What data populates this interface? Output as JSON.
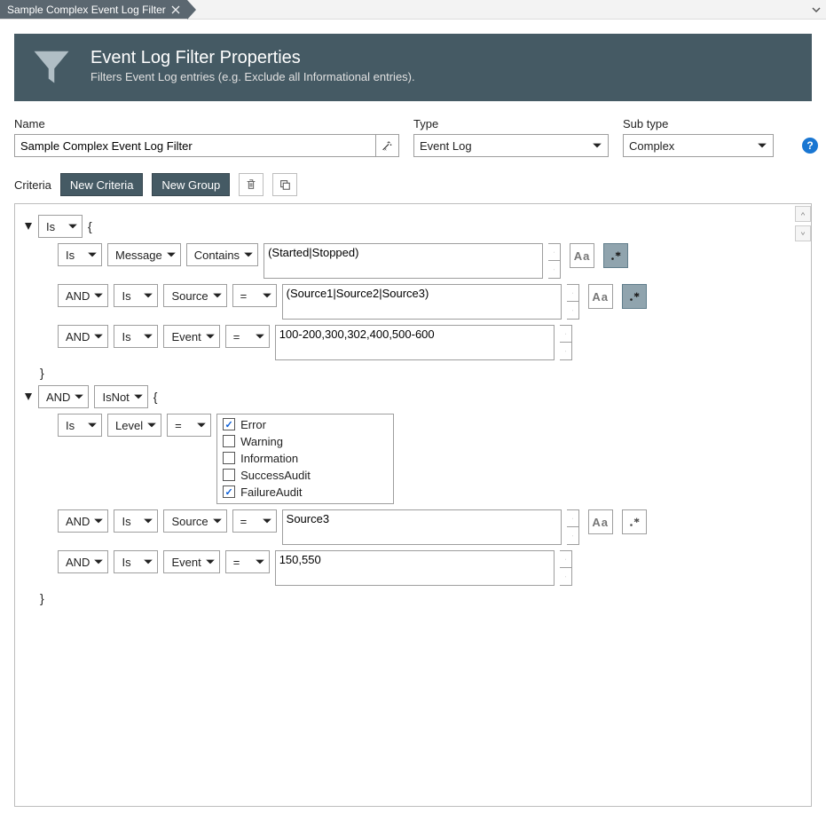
{
  "tab": {
    "title": "Sample Complex Event Log Filter"
  },
  "header": {
    "title": "Event Log Filter Properties",
    "subtitle": "Filters Event Log entries (e.g. Exclude all Informational entries)."
  },
  "form": {
    "name_label": "Name",
    "name_value": "Sample Complex Event Log Filter",
    "type_label": "Type",
    "type_value": "Event Log",
    "subtype_label": "Sub type",
    "subtype_value": "Complex"
  },
  "toolbar": {
    "criteria_label": "Criteria",
    "new_criteria": "New Criteria",
    "new_group": "New Group"
  },
  "opts": {
    "logic": {
      "and": "AND"
    },
    "polarity": {
      "is": "Is",
      "isnot": "IsNot"
    },
    "field": {
      "message": "Message",
      "source": "Source",
      "event": "Event",
      "level": "Level"
    },
    "op": {
      "contains": "Contains",
      "equals": "="
    }
  },
  "levels": {
    "error": {
      "label": "Error",
      "checked": true
    },
    "warning": {
      "label": "Warning",
      "checked": false
    },
    "information": {
      "label": "Information",
      "checked": false
    },
    "successaudit": {
      "label": "SuccessAudit",
      "checked": false
    },
    "failureaudit": {
      "label": "FailureAudit",
      "checked": true
    }
  },
  "criteria": {
    "g1": {
      "polarity": "Is",
      "r1": {
        "value": "(Started|Stopped)",
        "case": false,
        "regex_active": true
      },
      "r2": {
        "value": "(Source1|Source2|Source3)",
        "case": false,
        "regex_active": true
      },
      "r3": {
        "value": "100-200,300,302,400,500-600"
      }
    },
    "g2": {
      "logic": "AND",
      "polarity": "IsNot",
      "r1": {},
      "r2": {
        "value": "Source3",
        "case": false,
        "regex_active": false
      },
      "r3": {
        "value": "150,550"
      }
    }
  }
}
